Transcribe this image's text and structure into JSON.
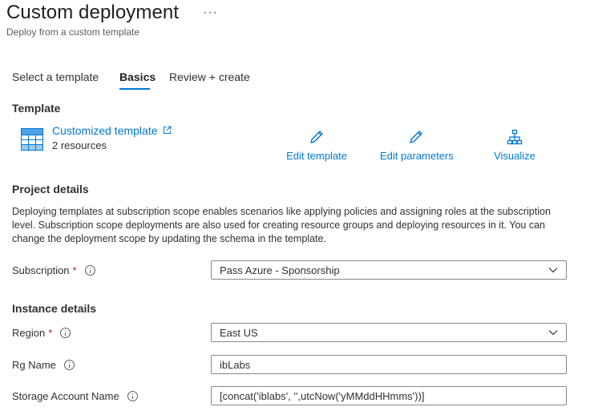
{
  "header": {
    "title": "Custom deployment",
    "more": "···",
    "subtitle": "Deploy from a custom template"
  },
  "tabs": [
    {
      "label": "Select a template",
      "active": false
    },
    {
      "label": "Basics",
      "active": true
    },
    {
      "label": "Review + create",
      "active": false
    }
  ],
  "template": {
    "heading": "Template",
    "name": "Customized template",
    "resources": "2 resources",
    "actions": {
      "edit_template": "Edit template",
      "edit_parameters": "Edit parameters",
      "visualize": "Visualize"
    }
  },
  "project": {
    "heading": "Project details",
    "description": "Deploying templates at subscription scope enables scenarios like applying policies and assigning roles at the subscription level. Subscription scope deployments are also used for creating resource groups and deploying resources in it. You can change the deployment scope by updating the schema in the template.",
    "subscription_label": "Subscription",
    "subscription_value": "Pass Azure - Sponsorship",
    "required_marker": "*"
  },
  "instance": {
    "heading": "Instance details",
    "region_label": "Region",
    "region_value": "East US",
    "rg_label": "Rg Name",
    "rg_value": "ibLabs",
    "storage_label": "Storage Account Name",
    "storage_value": "[concat('iblabs', '',utcNow('yMMddHHmms'))]"
  },
  "colors": {
    "accent": "#0078d4",
    "required": "#a4262c",
    "text": "#323130"
  }
}
